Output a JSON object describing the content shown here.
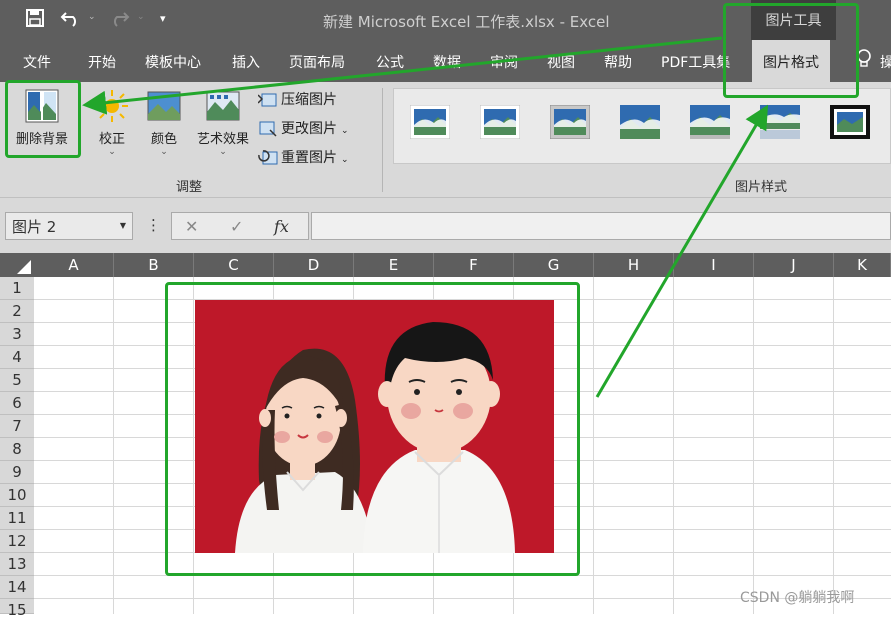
{
  "window": {
    "title": "新建 Microsoft Excel 工作表.xlsx  -  Excel",
    "context_tab_group": "图片工具"
  },
  "menu": {
    "tabs": [
      {
        "label": "文件"
      },
      {
        "label": "开始"
      },
      {
        "label": "模板中心"
      },
      {
        "label": "插入"
      },
      {
        "label": "页面布局"
      },
      {
        "label": "公式"
      },
      {
        "label": "数据"
      },
      {
        "label": "审阅"
      },
      {
        "label": "视图"
      },
      {
        "label": "帮助"
      },
      {
        "label": "PDF工具集"
      },
      {
        "label": "图片格式",
        "active": true
      }
    ],
    "tell_me_label": "操"
  },
  "ribbon": {
    "adjust": {
      "remove_background": "删除背景",
      "corrections": "校正",
      "color": "颜色",
      "artistic_effects": "艺术效果",
      "compress": "压缩图片",
      "change": "更改图片",
      "reset": "重置图片",
      "group_label": "调整"
    },
    "styles": {
      "group_label": "图片样式"
    }
  },
  "formula_bar": {
    "name_box": "图片 2",
    "cancel_glyph": "✕",
    "enter_glyph": "✓",
    "fx_label": "fx",
    "more_glyph": "⋮"
  },
  "sheet": {
    "columns": [
      "A",
      "B",
      "C",
      "D",
      "E",
      "F",
      "G",
      "H",
      "I",
      "J",
      "K"
    ],
    "rows": [
      "1",
      "2",
      "3",
      "4",
      "5",
      "6",
      "7",
      "8",
      "9",
      "10",
      "11",
      "12",
      "13",
      "14",
      "15"
    ]
  },
  "watermark": "CSDN @躺躺我啊",
  "colors": {
    "accent_green": "#22a62b",
    "picture_background": "#be1829",
    "ribbon": "#d9d9d9",
    "title_bar": "#5e5e5e"
  }
}
